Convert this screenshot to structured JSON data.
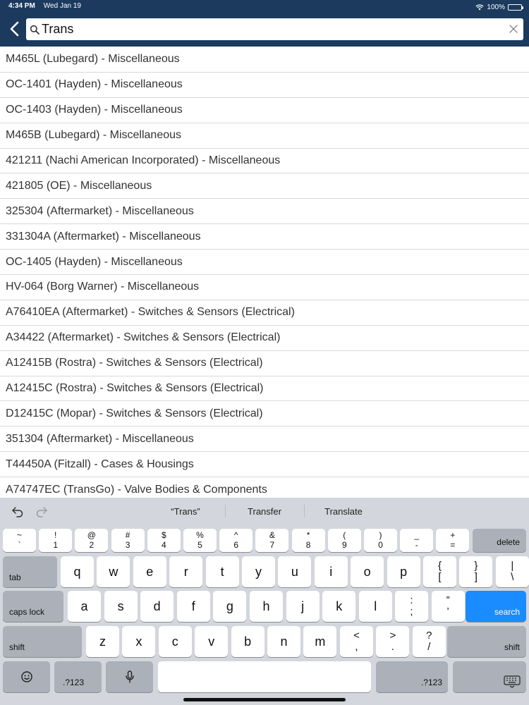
{
  "status_bar": {
    "time": "4:34 PM",
    "date": "Wed Jan 19",
    "battery": "100%"
  },
  "search": {
    "value": "Trans"
  },
  "results": [
    "M465L (Lubegard) - Miscellaneous",
    "OC-1401 (Hayden) - Miscellaneous",
    "OC-1403 (Hayden) - Miscellaneous",
    "M465B (Lubegard) - Miscellaneous",
    "421211 (Nachi American Incorporated) - Miscellaneous",
    "421805 (OE) - Miscellaneous",
    "325304 (Aftermarket) - Miscellaneous",
    "331304A (Aftermarket) - Miscellaneous",
    "OC-1405 (Hayden) - Miscellaneous",
    "HV-064 (Borg Warner) - Miscellaneous",
    "A76410EA (Aftermarket) - Switches & Sensors (Electrical)",
    "A34422 (Aftermarket) - Switches & Sensors (Electrical)",
    "A12415B (Rostra) - Switches & Sensors (Electrical)",
    "A12415C (Rostra) - Switches & Sensors (Electrical)",
    "D12415C (Mopar) - Switches & Sensors (Electrical)",
    "351304 (Aftermarket) - Miscellaneous",
    "T44450A (Fitzall) - Cases & Housings",
    "A74747EC (TransGo) - Valve Bodies & Components"
  ],
  "keyboard": {
    "suggestions": [
      "“Trans”",
      "Transfer",
      "Translate"
    ],
    "number_row": [
      {
        "top": "~",
        "bottom": "`"
      },
      {
        "top": "!",
        "bottom": "1"
      },
      {
        "top": "@",
        "bottom": "2"
      },
      {
        "top": "#",
        "bottom": "3"
      },
      {
        "top": "$",
        "bottom": "4"
      },
      {
        "top": "%",
        "bottom": "5"
      },
      {
        "top": "^",
        "bottom": "6"
      },
      {
        "top": "&",
        "bottom": "7"
      },
      {
        "top": "*",
        "bottom": "8"
      },
      {
        "top": "(",
        "bottom": "9"
      },
      {
        "top": ")",
        "bottom": "0"
      },
      {
        "top": "_",
        "bottom": "-"
      },
      {
        "top": "+",
        "bottom": "="
      }
    ],
    "delete_label": "delete",
    "tab_label": "tab",
    "row_q": [
      "q",
      "w",
      "e",
      "r",
      "t",
      "y",
      "u",
      "i",
      "o",
      "p"
    ],
    "row_q_symbols": [
      {
        "top": "{",
        "bottom": "["
      },
      {
        "top": "}",
        "bottom": "]"
      },
      {
        "top": "|",
        "bottom": "\\"
      }
    ],
    "caps_label": "caps lock",
    "row_a": [
      "a",
      "s",
      "d",
      "f",
      "g",
      "h",
      "j",
      "k",
      "l"
    ],
    "row_a_symbols": [
      {
        "top": ":",
        "bottom": ";"
      },
      {
        "top": "”",
        "bottom": "’"
      }
    ],
    "search_label": "search",
    "shift_label": "shift",
    "row_z": [
      "z",
      "x",
      "c",
      "v",
      "b",
      "n",
      "m"
    ],
    "row_z_symbols": [
      {
        "top": "<",
        "bottom": ","
      },
      {
        "top": ">",
        "bottom": "."
      },
      {
        "top": "?",
        "bottom": "/"
      }
    ],
    "num_label": ".?123",
    "accent_color": "#1a8cff"
  },
  "colors": {
    "header": "#1c3a5e",
    "keyboard_bg": "#d3d6dc"
  }
}
